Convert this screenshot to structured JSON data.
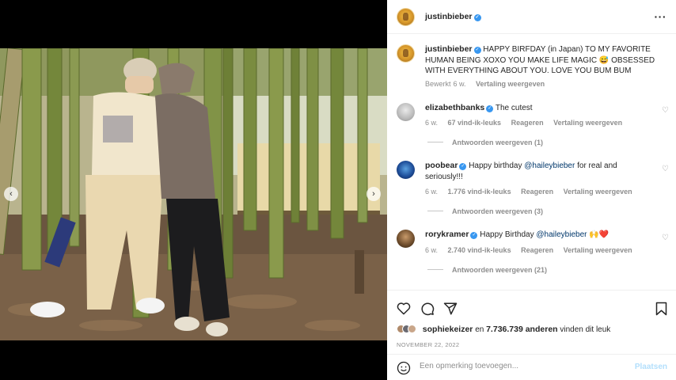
{
  "post": {
    "author": "justinbieber",
    "caption": "HAPPY BIRFDAY (in Japan) TO MY FAVORITE HUMAN BEING XOXO YOU MAKE LIFE MAGIC 😅 OBSESSED WITH EVERYTHING ABOUT YOU. LOVE YOU BUM BUM",
    "caption_meta": {
      "edited": "Bewerkt",
      "time": "6 w.",
      "translate": "Vertaling weergeven"
    },
    "likes": {
      "user": "sophiekeizer",
      "and": "en",
      "count": "7.736.739 anderen",
      "suffix": "vinden dit leuk"
    },
    "date": "NOVEMBER 22, 2022"
  },
  "comments": [
    {
      "user": "elizabethbanks",
      "text": "The cutest",
      "time": "6 w.",
      "likes": "67 vind-ik-leuks",
      "reply": "Reageren",
      "translate": "Vertaling weergeven",
      "replies": "Antwoorden weergeven (1)"
    },
    {
      "user": "poobear",
      "text_before": "Happy birthday ",
      "mention": "@haileybieber",
      "text_after": " for real and seriously!!!",
      "time": "6 w.",
      "likes": "1.776 vind-ik-leuks",
      "reply": "Reageren",
      "translate": "Vertaling weergeven",
      "replies": "Antwoorden weergeven (3)"
    },
    {
      "user": "rorykramer",
      "text_before": "Happy Birthday ",
      "mention": "@haileybieber",
      "text_after": " 🙌❤️",
      "time": "6 w.",
      "likes": "2.740 vind-ik-leuks",
      "reply": "Reageren",
      "translate": "Vertaling weergeven",
      "replies": "Antwoorden weergeven (21)"
    }
  ],
  "add_comment": {
    "placeholder": "Een opmerking toevoegen...",
    "post_label": "Plaatsen"
  },
  "icons": {
    "more": "more-options-icon",
    "like": "heart-icon",
    "comment": "comment-icon",
    "share": "share-icon",
    "save": "bookmark-icon",
    "emoji": "emoji-icon",
    "prev": "chevron-left-icon",
    "next": "chevron-right-icon"
  },
  "colors": {
    "verified": "#3897f0",
    "post_button": "#b2dffc",
    "mention": "#00376b",
    "meta": "#8e8e8e"
  }
}
